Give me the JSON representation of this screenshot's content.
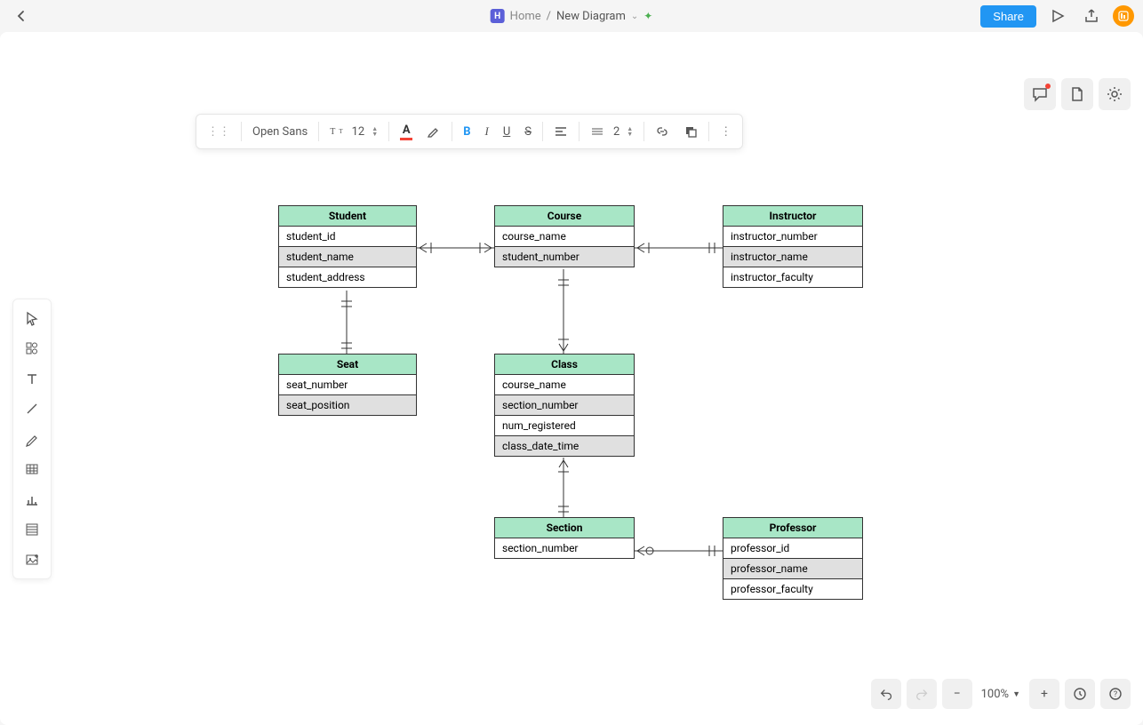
{
  "header": {
    "home_label": "Home",
    "separator": "/",
    "doc_title": "New Diagram",
    "share_label": "Share",
    "home_icon_letter": "H"
  },
  "format_toolbar": {
    "font_name": "Open Sans",
    "font_size": "12",
    "line_weight": "2"
  },
  "zoom": {
    "level": "100%"
  },
  "entities": {
    "student": {
      "title": "Student",
      "fields": [
        "student_id",
        "student_name",
        "student_address"
      ]
    },
    "course": {
      "title": "Course",
      "fields": [
        "course_name",
        "student_number"
      ]
    },
    "instructor": {
      "title": "Instructor",
      "fields": [
        "instructor_number",
        "instructor_name",
        "instructor_faculty"
      ]
    },
    "seat": {
      "title": "Seat",
      "fields": [
        "seat_number",
        "seat_position"
      ]
    },
    "class": {
      "title": "Class",
      "fields": [
        "course_name",
        "section_number",
        "num_registered",
        "class_date_time"
      ]
    },
    "section": {
      "title": "Section",
      "fields": [
        "section_number"
      ]
    },
    "professor": {
      "title": "Professor",
      "fields": [
        "professor_id",
        "professor_name",
        "professor_faculty"
      ]
    }
  }
}
